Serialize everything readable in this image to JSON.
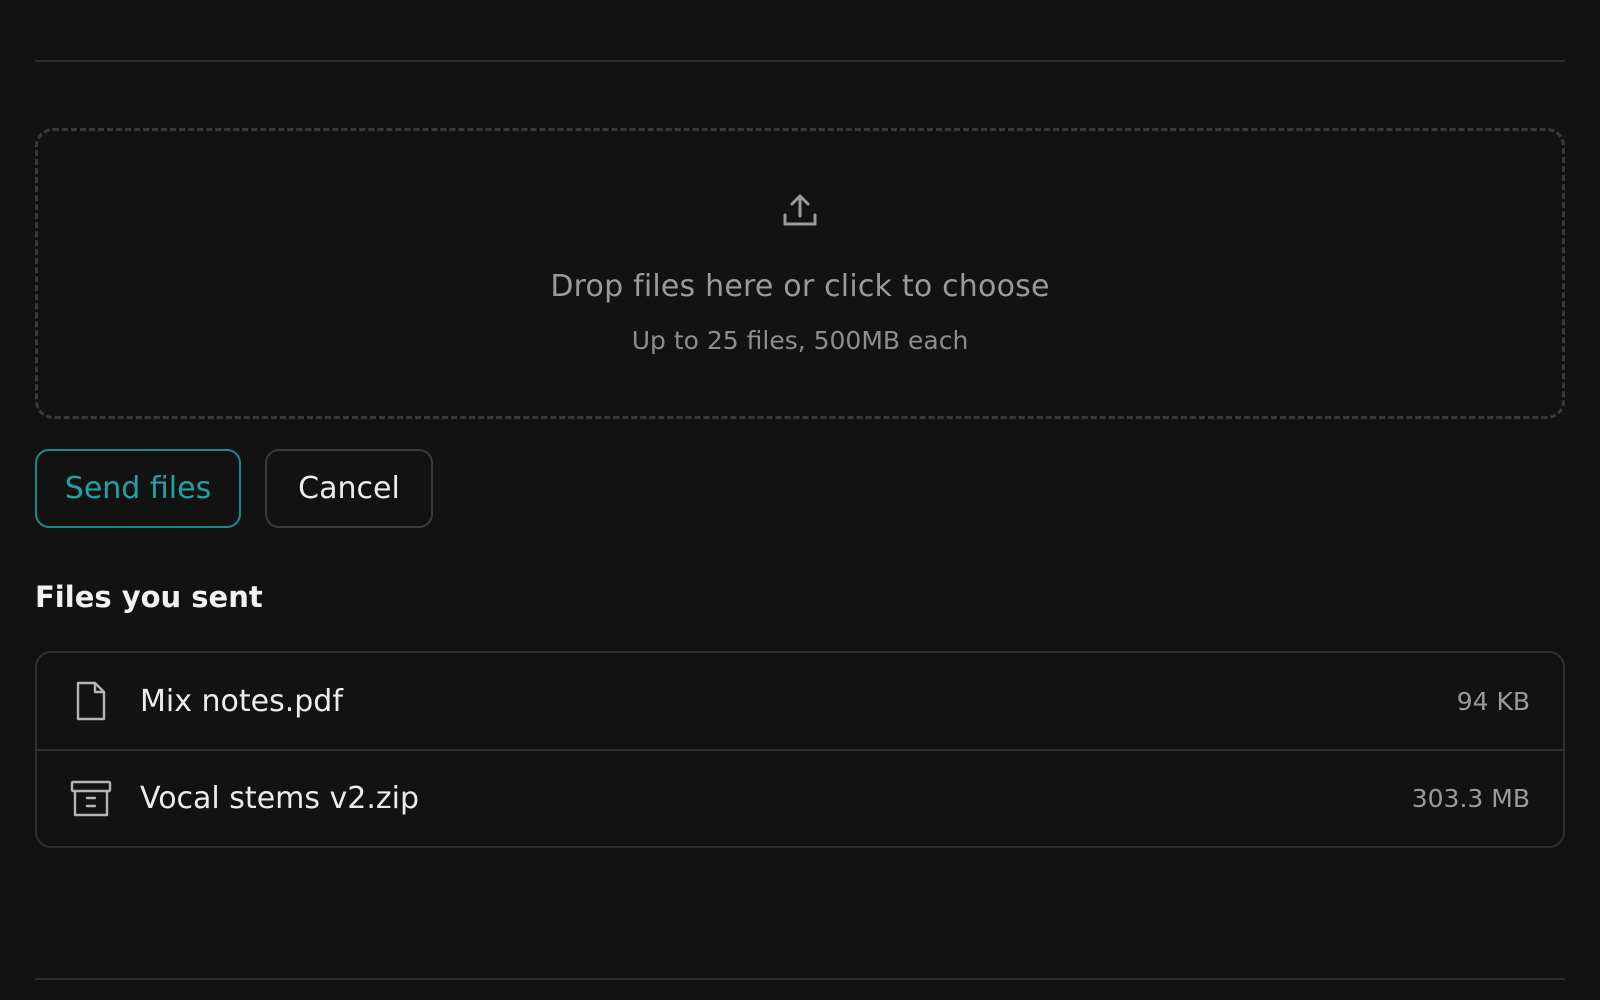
{
  "dropzone": {
    "icon": "upload-icon",
    "title": "Drop files here or click to choose",
    "subtitle": "Up to 25 files, 500MB each"
  },
  "actions": {
    "send_label": "Send files",
    "cancel_label": "Cancel"
  },
  "sent_files": {
    "heading": "Files you sent",
    "items": [
      {
        "icon": "document-icon",
        "name": "Mix notes.pdf",
        "size": "94 KB"
      },
      {
        "icon": "archive-icon",
        "name": "Vocal stems v2.zip",
        "size": "303.3 MB"
      }
    ]
  },
  "colors": {
    "background": "#121212",
    "accent": "#1fa3a3",
    "border": "#2f2f2f",
    "muted_text": "#9a9a9a"
  }
}
